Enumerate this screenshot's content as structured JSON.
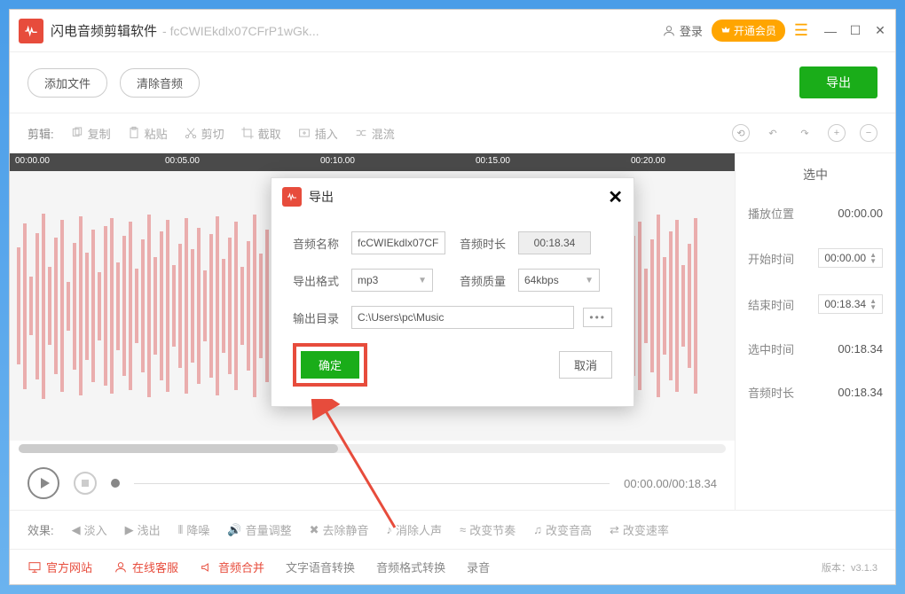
{
  "titlebar": {
    "app_name": "闪电音频剪辑软件",
    "file_name": "- fcCWIEkdlx07CFrP1wGk...",
    "login": "登录",
    "vip": "开通会员"
  },
  "toolbar1": {
    "add_file": "添加文件",
    "clear": "清除音频",
    "export": "导出"
  },
  "toolbar2": {
    "label": "剪辑:",
    "copy": "复制",
    "paste": "粘贴",
    "cut": "剪切",
    "crop": "截取",
    "insert": "插入",
    "mix": "混流",
    "selected_title": "选中"
  },
  "ruler": {
    "t0": "00:00.00",
    "t1": "00:05.00",
    "t2": "00:10.00",
    "t3": "00:15.00",
    "t4": "00:20.00"
  },
  "playback": {
    "time": "00:00.00/00:18.34"
  },
  "sidebar": {
    "play_pos_label": "播放位置",
    "play_pos": "00:00.00",
    "start_label": "开始时间",
    "start": "00:00.00",
    "end_label": "结束时间",
    "end": "00:18.34",
    "sel_label": "选中时间",
    "sel": "00:18.34",
    "dur_label": "音频时长",
    "dur": "00:18.34"
  },
  "effects": {
    "label": "效果:",
    "fadein": "淡入",
    "fadeout": "浅出",
    "denoise": "降噪",
    "volume": "音量调整",
    "silence": "去除静音",
    "vocals": "消除人声",
    "tempo": "改变节奏",
    "pitch": "改变音高",
    "speed": "改变速率"
  },
  "bottom": {
    "site": "官方网站",
    "support": "在线客服",
    "merge": "音频合并",
    "tts": "文字语音转换",
    "format": "音频格式转换",
    "record": "录音",
    "version": "版本：v3.1.3"
  },
  "dialog": {
    "title": "导出",
    "name_label": "音频名称",
    "name": "fcCWIEkdlx07CF",
    "dur_label": "音频时长",
    "dur": "00:18.34",
    "fmt_label": "导出格式",
    "fmt": "mp3",
    "quality_label": "音频质量",
    "quality": "64kbps",
    "dir_label": "输出目录",
    "dir": "C:\\Users\\pc\\Music",
    "browse": "•••",
    "confirm": "确定",
    "cancel": "取消"
  }
}
